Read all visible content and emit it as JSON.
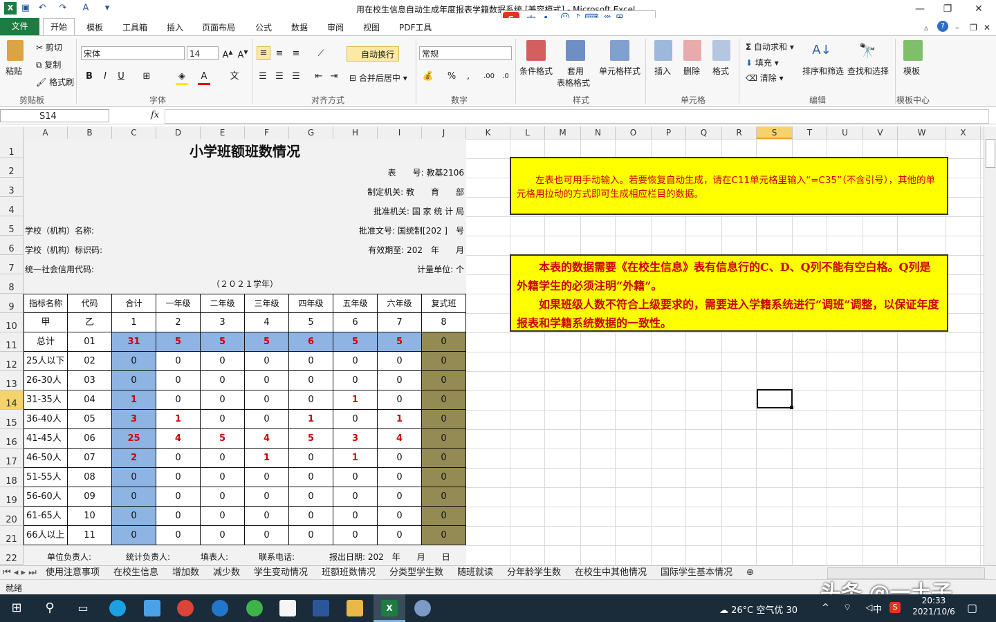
{
  "window": {
    "title": "用在校生信息自动生成年度报表学籍数据系统 [兼容模式] - Microsoft Excel",
    "ime_label": "中"
  },
  "ribbon_tabs": [
    "文件",
    "开始",
    "模板",
    "工具箱",
    "插入",
    "页面布局",
    "公式",
    "数据",
    "审阅",
    "视图",
    "PDF工具"
  ],
  "ribbon": {
    "clipboard": {
      "paste": "粘贴",
      "cut": "剪切",
      "copy": "复制",
      "format_painter": "格式刷",
      "label": "剪贴板"
    },
    "font": {
      "name": "宋体",
      "size": "14",
      "label": "字体"
    },
    "alignment": {
      "autowrap": "自动换行",
      "merge": "合并后居中",
      "label": "对齐方式"
    },
    "number": {
      "format": "常规",
      "label": "数字"
    },
    "styles": {
      "cond": "条件格式",
      "table": "套用",
      "table2": "表格格式",
      "cell": "单元格样式",
      "label": "样式"
    },
    "cells": {
      "insert": "插入",
      "delete": "删除",
      "format": "格式",
      "label": "单元格"
    },
    "editing": {
      "autosum": "自动求和",
      "fill": "填充",
      "clear": "清除",
      "sort": "排序和筛选",
      "find": "查找和选择",
      "label": "编辑"
    },
    "template": {
      "btn": "模板",
      "label": "模板中心"
    }
  },
  "formula_bar": {
    "name_box": "S14",
    "fx": "fx",
    "value": ""
  },
  "columns": [
    "A",
    "B",
    "C",
    "D",
    "E",
    "F",
    "G",
    "H",
    "I",
    "J",
    "K",
    "L",
    "M",
    "N",
    "O",
    "P",
    "Q",
    "R",
    "S",
    "T",
    "U",
    "V",
    "W",
    "X"
  ],
  "selected_col": "S",
  "rows": [
    "1",
    "2",
    "3",
    "4",
    "5",
    "6",
    "7",
    "8",
    "9",
    "10",
    "11",
    "12",
    "13",
    "14",
    "15",
    "16",
    "17",
    "18",
    "19",
    "20",
    "21",
    "22"
  ],
  "selected_row": "14",
  "report": {
    "title": "小学班额班数情况",
    "meta_right": [
      "表　　号: 教基2106",
      "制定机关: 教　　育　　部",
      "批准机关: 国 家 统 计 局",
      "批准文号: 国统制[202 ]　号",
      "有效期至: 202　年　　月",
      "计量单位: 个"
    ],
    "meta_left": [
      "学校（机构）名称:",
      "学校（机构）标识码:",
      "统一社会信用代码:"
    ],
    "school_year": "（２０２１学年）",
    "headers": [
      "指标名称",
      "代码",
      "合计",
      "一年级",
      "二年级",
      "三年级",
      "四年级",
      "五年级",
      "六年级",
      "复式班"
    ],
    "subheaders": [
      "甲",
      "乙",
      "1",
      "2",
      "3",
      "4",
      "5",
      "6",
      "7",
      "8"
    ],
    "rows": [
      [
        "总计",
        "01",
        "31",
        "5",
        "5",
        "5",
        "6",
        "5",
        "5",
        "0"
      ],
      [
        "25人以下",
        "02",
        "0",
        "0",
        "0",
        "0",
        "0",
        "0",
        "0",
        "0"
      ],
      [
        "26-30人",
        "03",
        "0",
        "0",
        "0",
        "0",
        "0",
        "0",
        "0",
        "0"
      ],
      [
        "31-35人",
        "04",
        "1",
        "0",
        "0",
        "0",
        "0",
        "1",
        "0",
        "0"
      ],
      [
        "36-40人",
        "05",
        "3",
        "1",
        "0",
        "0",
        "1",
        "0",
        "1",
        "0"
      ],
      [
        "41-45人",
        "06",
        "25",
        "4",
        "5",
        "4",
        "5",
        "3",
        "4",
        "0"
      ],
      [
        "46-50人",
        "07",
        "2",
        "0",
        "0",
        "1",
        "0",
        "1",
        "0",
        "0"
      ],
      [
        "51-55人",
        "08",
        "0",
        "0",
        "0",
        "0",
        "0",
        "0",
        "0",
        "0"
      ],
      [
        "56-60人",
        "09",
        "0",
        "0",
        "0",
        "0",
        "0",
        "0",
        "0",
        "0"
      ],
      [
        "61-65人",
        "10",
        "0",
        "0",
        "0",
        "0",
        "0",
        "0",
        "0",
        "0"
      ],
      [
        "66人以上",
        "11",
        "0",
        "0",
        "0",
        "0",
        "0",
        "0",
        "0",
        "0"
      ]
    ],
    "footer": [
      "单位负责人:",
      "统计负责人:",
      "填表人:",
      "联系电话:",
      "报出日期: 202　年　　月　　日"
    ]
  },
  "notes": [
    "　　左表也可用手动输入。若要恢复自动生成，请在C11单元格里输入“=C35”（不含引号），其他的单元格用拉动的方式即可生成相应栏目的数据。",
    "　　本表的数据需要《在校生信息》表有信息行的C、D、Q列不能有空白格。Q列是外籍学生的必须注明“外籍”。",
    "　　如果班级人数不符合上级要求的，需要进入学籍系统进行“调班”调整，以保证年度报表和学籍系统数据的一致性。"
  ],
  "sheet_tabs": [
    "使用注意事项",
    "在校生信息",
    "增加数",
    "减少数",
    "学生变动情况",
    "班额班数情况",
    "分类型学生数",
    "随班就读",
    "分年龄学生数",
    "在校生中其他情况",
    "国际学生基本情况"
  ],
  "active_sheet": "班额班数情况",
  "status": "就绪",
  "taskbar": {
    "weather": "26°C 空气优 30",
    "time": "20:33",
    "date": "2021/10/6",
    "ime": "中"
  },
  "watermark": "头条 @一土子",
  "colors": {
    "excel_green": "#1e7b42",
    "blue_cell": "#8db4e2",
    "olive_cell": "#948a54",
    "note_bg": "#ffff00",
    "red_text": "#cc0000"
  }
}
